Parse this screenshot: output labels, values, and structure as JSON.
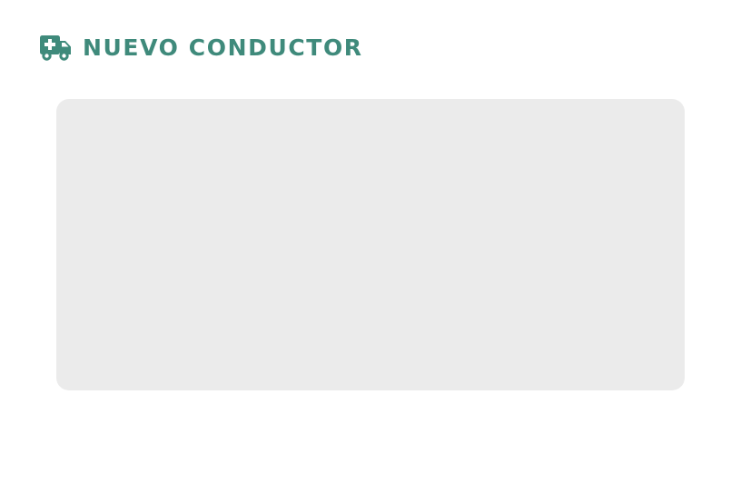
{
  "header": {
    "title": "NUEVO CONDUCTOR",
    "icon": "ambulance-icon"
  },
  "colors": {
    "accent": "#3f8a7b",
    "panel_background": "#ebebeb",
    "page_background": "#ffffff"
  }
}
